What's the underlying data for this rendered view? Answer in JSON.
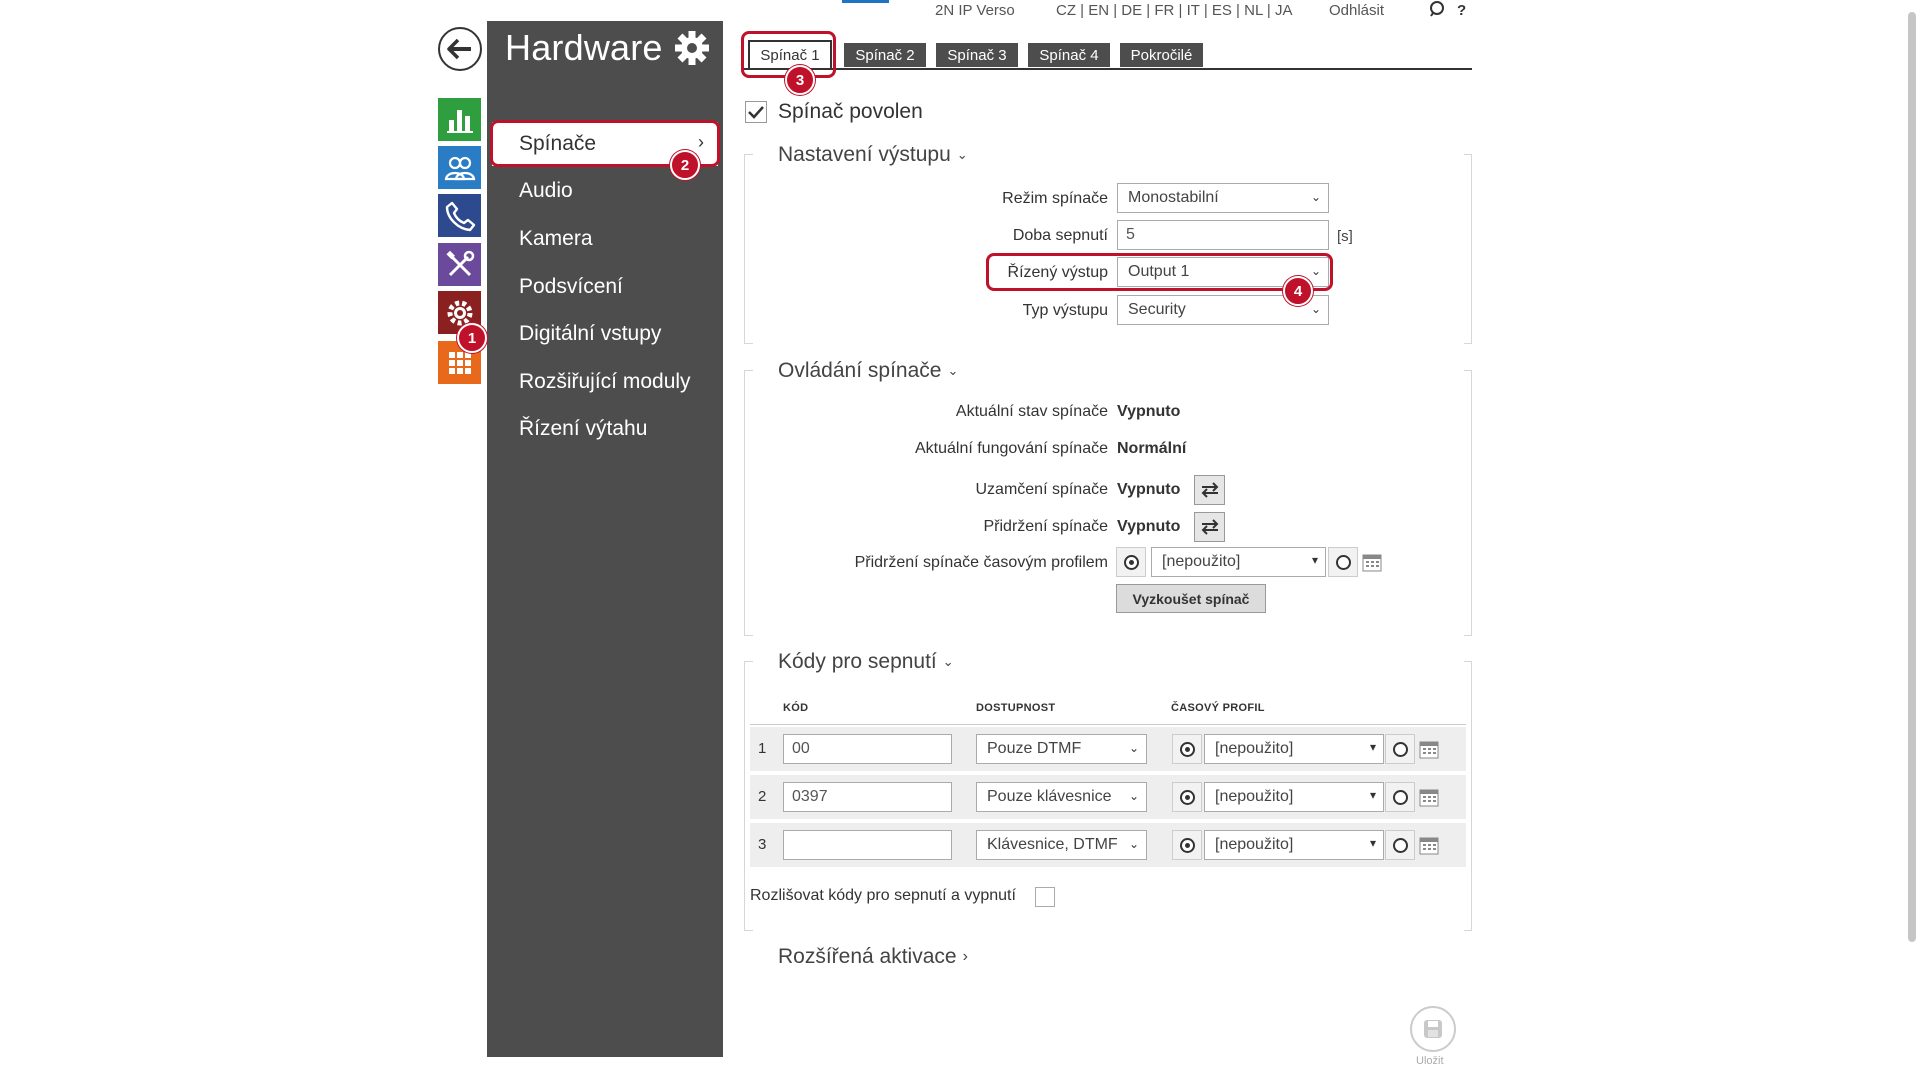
{
  "header": {
    "product": "2N IP Verso",
    "languages": "CZ | EN | DE | FR | IT | ES | NL | JA",
    "logout": "Odhlásit",
    "search_icon": "search-icon",
    "help": "?"
  },
  "sidebar": {
    "title": "Hardware",
    "items": [
      {
        "label": "Spínače",
        "active": true
      },
      {
        "label": "Audio"
      },
      {
        "label": "Kamera"
      },
      {
        "label": "Podsvícení"
      },
      {
        "label": "Digitální vstupy"
      },
      {
        "label": "Rozšiřující moduly"
      },
      {
        "label": "Řízení výtahu"
      }
    ],
    "module_icons": [
      "status-icon",
      "directory-icon",
      "calls-icon",
      "services-icon",
      "hardware-icon",
      "system-icon"
    ]
  },
  "tabs": [
    "Spínač 1",
    "Spínač 2",
    "Spínač 3",
    "Spínač 4",
    "Pokročilé"
  ],
  "switch_enabled": {
    "label": "Spínač povolen",
    "checked": true
  },
  "output_settings": {
    "title": "Nastavení výstupu",
    "mode_label": "Režim spínače",
    "mode_value": "Monostabilní",
    "duration_label": "Doba sepnutí",
    "duration_value": "5",
    "duration_unit": "[s]",
    "controlled_output_label": "Řízený výstup",
    "controlled_output_value": "Output 1",
    "output_type_label": "Typ výstupu",
    "output_type_value": "Security"
  },
  "switch_control": {
    "title": "Ovládání spínače",
    "state_label": "Aktuální stav spínače",
    "state_value": "Vypnuto",
    "function_label": "Aktuální fungování spínače",
    "function_value": "Normální",
    "lock_label": "Uzamčení spínače",
    "lock_value": "Vypnuto",
    "hold_label": "Přidržení spínače",
    "hold_value": "Vypnuto",
    "hold_profile_label": "Přidržení spínače časovým profilem",
    "hold_profile_value": "[nepoužito]",
    "test_button": "Vyzkoušet spínač"
  },
  "codes": {
    "title": "Kódy pro sepnutí",
    "columns": [
      "KÓD",
      "DOSTUPNOST",
      "ČASOVÝ PROFIL"
    ],
    "rows": [
      {
        "n": "1",
        "code": "00",
        "availability": "Pouze DTMF",
        "profile": "[nepoužito]"
      },
      {
        "n": "2",
        "code": "0397",
        "availability": "Pouze klávesnice",
        "profile": "[nepoužito]"
      },
      {
        "n": "3",
        "code": "",
        "availability": "Klávesnice, DTMF",
        "profile": "[nepoužito]"
      }
    ],
    "distinguish_label": "Rozlišovat kódy pro sepnutí a vypnutí",
    "distinguish_checked": false
  },
  "extended": {
    "title": "Rozšířená aktivace"
  },
  "save": {
    "label": "Uložit"
  },
  "annotations": [
    "1",
    "2",
    "3",
    "4"
  ],
  "colors": {
    "accent_red": "#c0112a",
    "sidebar_bg": "#4d4d4d",
    "status_green": "#2e9e3e",
    "directory_blue": "#2a7cc4",
    "calls_navy": "#2e4a8f",
    "services_purple": "#6b4a9c",
    "hardware_darkred": "#8b2020",
    "system_orange": "#e8691c"
  }
}
